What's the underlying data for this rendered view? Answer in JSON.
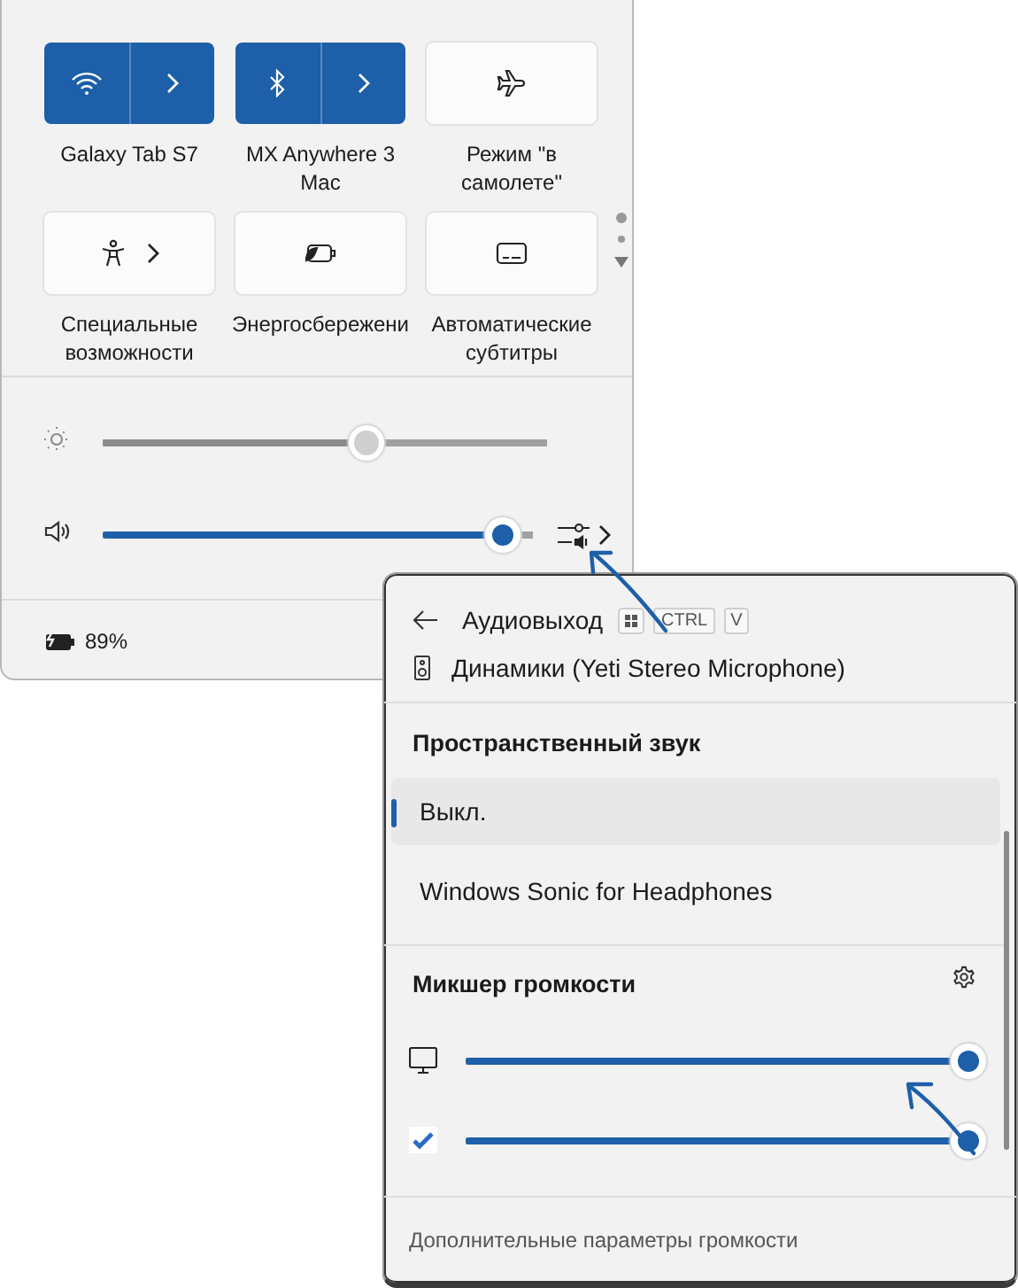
{
  "quick_settings": {
    "tiles": [
      {
        "kind": "split",
        "label": "Galaxy Tab S7",
        "on": true
      },
      {
        "kind": "split",
        "label": "MX Anywhere 3 Mac",
        "on": true
      },
      {
        "kind": "single",
        "label": "Режим \"в самолете\"",
        "on": false
      },
      {
        "kind": "expand",
        "label": "Специальные возможности",
        "on": false
      },
      {
        "kind": "single",
        "label": "Энергосбережени",
        "on": false
      },
      {
        "kind": "single",
        "label": "Автоматические субтитры",
        "on": false
      }
    ],
    "brightness": {
      "level": 0.6
    },
    "volume": {
      "level": 0.97
    },
    "battery": "89%"
  },
  "audio_output": {
    "title": "Аудиовыход",
    "shortcut_keys": [
      "CTRL",
      "V"
    ],
    "device": "Динамики (Yeti Stereo Microphone)",
    "spatial_sound": {
      "heading": "Пространственный звук",
      "options": [
        {
          "label": "Выкл.",
          "selected": true
        },
        {
          "label": "Windows Sonic for Headphones",
          "selected": false
        }
      ]
    },
    "mixer": {
      "heading": "Микшер громкости",
      "apps": [
        {
          "level": 1
        },
        {
          "level": 1
        }
      ]
    },
    "more_link": "Дополнительные параметры громкости"
  }
}
